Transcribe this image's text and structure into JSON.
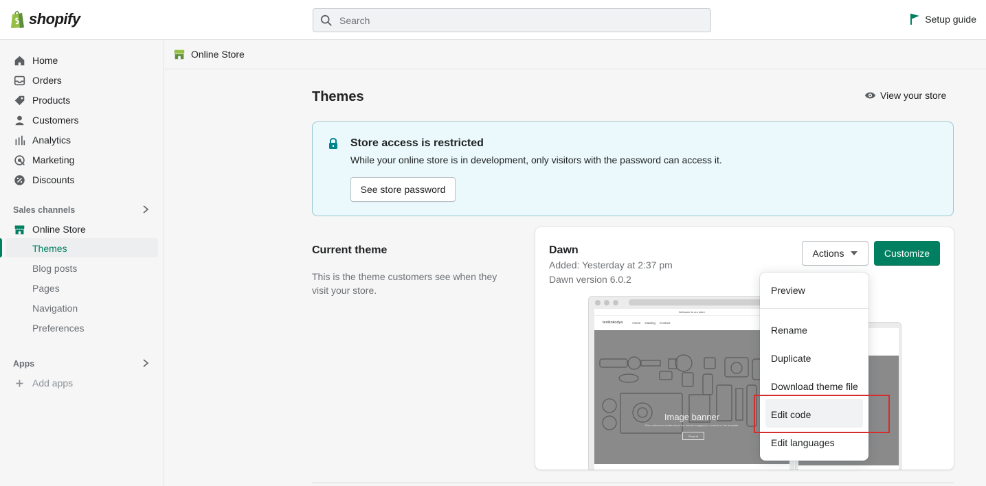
{
  "brand": {
    "name": "shopify",
    "accent": "#008060"
  },
  "topbar": {
    "search_placeholder": "Search",
    "setup_guide": "Setup guide"
  },
  "sidebar": {
    "items": [
      {
        "label": "Home",
        "icon": "home-icon"
      },
      {
        "label": "Orders",
        "icon": "inbox-icon"
      },
      {
        "label": "Products",
        "icon": "tag-icon"
      },
      {
        "label": "Customers",
        "icon": "person-icon"
      },
      {
        "label": "Analytics",
        "icon": "bar-chart-icon"
      },
      {
        "label": "Marketing",
        "icon": "target-icon"
      },
      {
        "label": "Discounts",
        "icon": "discount-icon"
      }
    ],
    "sales_channels_label": "Sales channels",
    "online_store": "Online Store",
    "sub_items": [
      "Themes",
      "Blog posts",
      "Pages",
      "Navigation",
      "Preferences"
    ],
    "apps_label": "Apps",
    "add_apps": "Add apps"
  },
  "breadcrumb": {
    "label": "Online Store"
  },
  "page": {
    "title": "Themes",
    "view_store": "View your store"
  },
  "banner": {
    "title": "Store access is restricted",
    "text": "While your online store is in development, only visitors with the password can access it.",
    "button": "See store password"
  },
  "current_theme": {
    "heading": "Current theme",
    "description": "This is the theme customers see when they visit your store.",
    "name": "Dawn",
    "added": "Added: Yesterday at 2:37 pm",
    "version": "Dawn version 6.0.2",
    "actions_label": "Actions",
    "customize_label": "Customize",
    "preview": {
      "announcement": "Welcome to our store",
      "store_name": "testkokodya",
      "nav": [
        "Home",
        "Catalog",
        "Contact"
      ],
      "hero_title": "Image banner",
      "hero_sub": "Give customers details about the banner image(s) or content on the template.",
      "hero_button": "Shop all"
    }
  },
  "actions_menu": {
    "items": [
      "Preview",
      "Rename",
      "Duplicate",
      "Download theme file",
      "Edit code",
      "Edit languages"
    ],
    "highlighted": "Edit code"
  }
}
